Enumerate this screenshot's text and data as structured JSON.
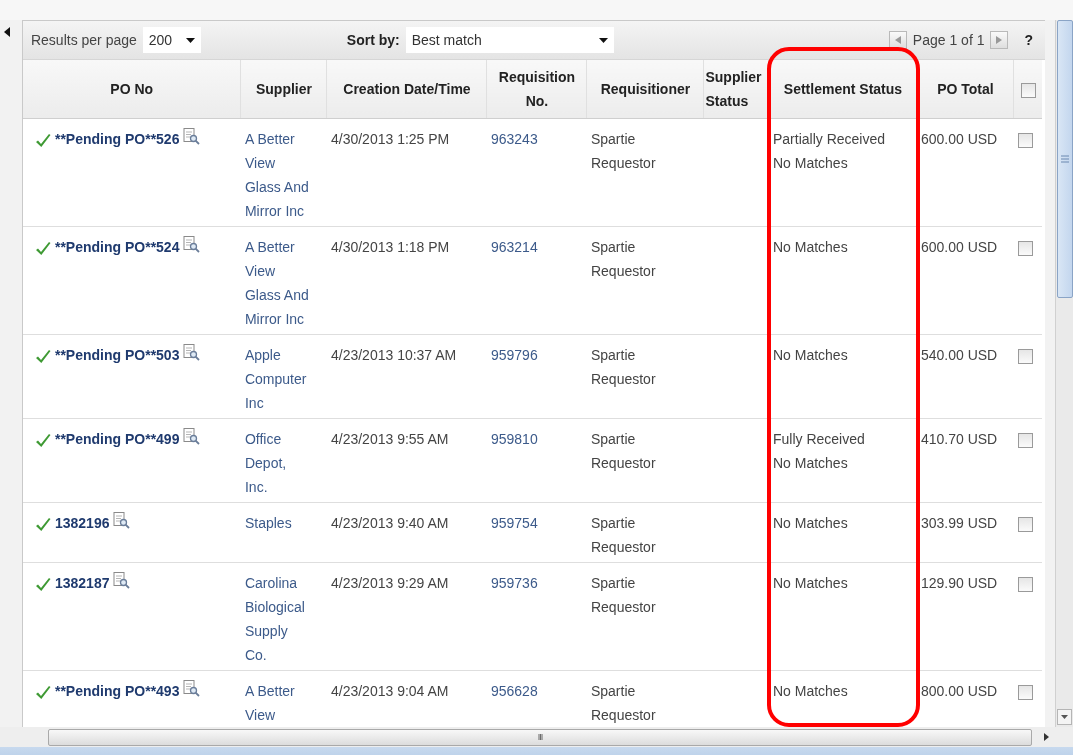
{
  "toolbar": {
    "results_label": "Results per page",
    "results_value": "200",
    "sort_label": "Sort by:",
    "sort_value": "Best match",
    "page_text": "Page 1 of 1",
    "help": "?"
  },
  "columns": [
    {
      "label": "PO No"
    },
    {
      "label": "Supplier"
    },
    {
      "label": "Creation Date/Time"
    },
    {
      "label": "Requisition No."
    },
    {
      "label": "Requisitioner"
    },
    {
      "label": "Supplier Status"
    },
    {
      "label": "Settlement Status"
    },
    {
      "label": "PO Total"
    }
  ],
  "header_checked": false,
  "rows": [
    {
      "po": "**Pending PO**526",
      "approved": true,
      "supplier": [
        "A Better",
        "View",
        "Glass And",
        "Mirror Inc"
      ],
      "created": "4/30/2013 1:25 PM",
      "requisition": "963243",
      "requisitioner": "Spartie Requestor",
      "settlement": [
        "Partially Received",
        "No Matches"
      ],
      "total": "600.00 USD",
      "checked": false
    },
    {
      "po": "**Pending PO**524",
      "approved": true,
      "supplier": [
        "A Better",
        "View",
        "Glass And",
        "Mirror Inc"
      ],
      "created": "4/30/2013 1:18 PM",
      "requisition": "963214",
      "requisitioner": "Spartie Requestor",
      "settlement": [
        "No Matches"
      ],
      "total": "600.00 USD",
      "checked": false
    },
    {
      "po": "**Pending PO**503",
      "approved": true,
      "supplier": [
        "Apple",
        "Computer",
        "Inc"
      ],
      "created": "4/23/2013 10:37 AM",
      "requisition": "959796",
      "requisitioner": "Spartie Requestor",
      "settlement": [
        "No Matches"
      ],
      "total": "540.00 USD",
      "checked": false
    },
    {
      "po": "**Pending PO**499",
      "approved": true,
      "supplier": [
        "Office",
        "Depot,",
        "Inc."
      ],
      "created": "4/23/2013 9:55 AM",
      "requisition": "959810",
      "requisitioner": "Spartie Requestor",
      "settlement": [
        "Fully Received",
        "No Matches"
      ],
      "total": "410.70 USD",
      "checked": false
    },
    {
      "po": "1382196",
      "approved": true,
      "supplier": [
        "Staples"
      ],
      "created": "4/23/2013 9:40 AM",
      "requisition": "959754",
      "requisitioner": "Spartie Requestor",
      "settlement": [
        "No Matches"
      ],
      "total": "303.99 USD",
      "checked": false
    },
    {
      "po": "1382187",
      "approved": true,
      "supplier": [
        "Carolina",
        "Biological",
        "Supply",
        "Co."
      ],
      "created": "4/23/2013 9:29 AM",
      "requisition": "959736",
      "requisitioner": "Spartie Requestor",
      "settlement": [
        "No Matches"
      ],
      "total": "129.90 USD",
      "checked": false
    },
    {
      "po": "**Pending PO**493",
      "approved": true,
      "supplier": [
        "A Better",
        "View"
      ],
      "created": "4/23/2013 9:04 AM",
      "requisition": "956628",
      "requisitioner": "Spartie Requestor",
      "settlement": [
        "No Matches"
      ],
      "total": "800.00 USD",
      "checked": false
    }
  ],
  "scrollbar_grip": "III"
}
